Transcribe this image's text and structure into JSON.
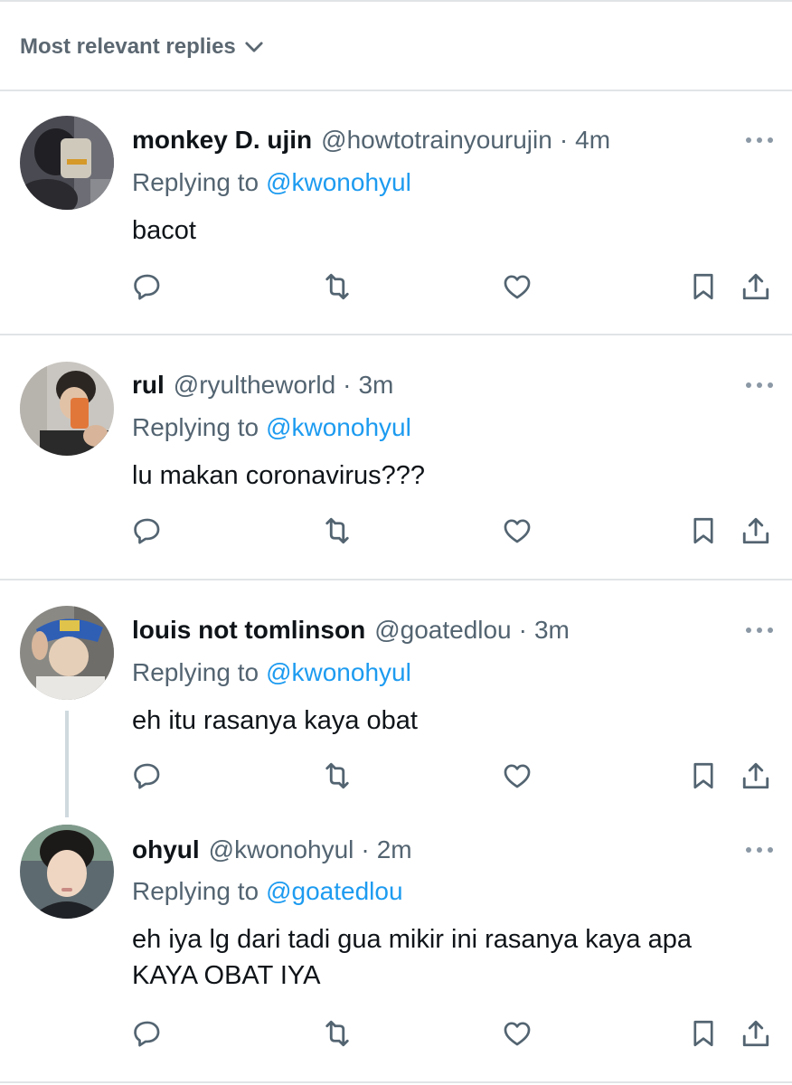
{
  "sort": {
    "label": "Most relevant replies"
  },
  "reply_prefix": "Replying to",
  "colors": {
    "accent": "#1d9bf0",
    "secondary_text": "#536471",
    "divider": "#e1e4e6"
  },
  "tweets": [
    {
      "name": "monkey D. ujin",
      "handle": "@howtotrainyourujin",
      "sep": "·",
      "time": "4m",
      "replying_to": "@kwonohyul",
      "text": "bacot"
    },
    {
      "name": "rul",
      "handle": "@ryultheworld",
      "sep": "·",
      "time": "3m",
      "replying_to": "@kwonohyul",
      "text": "lu makan coronavirus???"
    },
    {
      "name": "louis not tomlinson",
      "handle": "@goatedlou",
      "sep": "·",
      "time": "3m",
      "replying_to": "@kwonohyul",
      "text": "eh itu rasanya kaya obat"
    },
    {
      "name": "ohyul",
      "handle": "@kwonohyul",
      "sep": "·",
      "time": "2m",
      "replying_to": "@goatedlou",
      "text_line1": "eh iya lg dari tadi gua mikir ini rasanya kaya apa",
      "text_line2": "KAYA OBAT IYA"
    }
  ],
  "icons": [
    "reply-icon",
    "retweet-icon",
    "like-icon",
    "bookmark-icon",
    "share-icon",
    "more-icon",
    "chevron-down-icon"
  ]
}
